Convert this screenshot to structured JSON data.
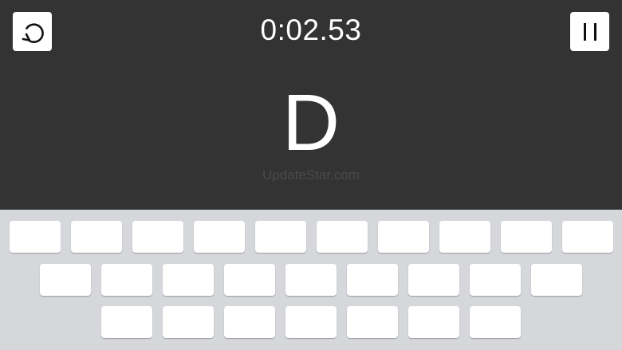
{
  "header": {
    "timer": "0:02.53",
    "restart_icon": "restart-icon",
    "pause_icon": "pause-icon"
  },
  "game": {
    "target_letter": "D",
    "watermark": "UpdateStar.com"
  },
  "keyboard": {
    "rows": [
      [
        "",
        "",
        "",
        "",
        "",
        "",
        "",
        "",
        "",
        ""
      ],
      [
        "",
        "",
        "",
        "",
        "",
        "",
        "",
        "",
        ""
      ],
      [
        "",
        "",
        "",
        "",
        "",
        "",
        ""
      ]
    ]
  },
  "colors": {
    "top_background": "#333333",
    "keyboard_background": "#d5d7db",
    "key_background": "#ffffff"
  }
}
